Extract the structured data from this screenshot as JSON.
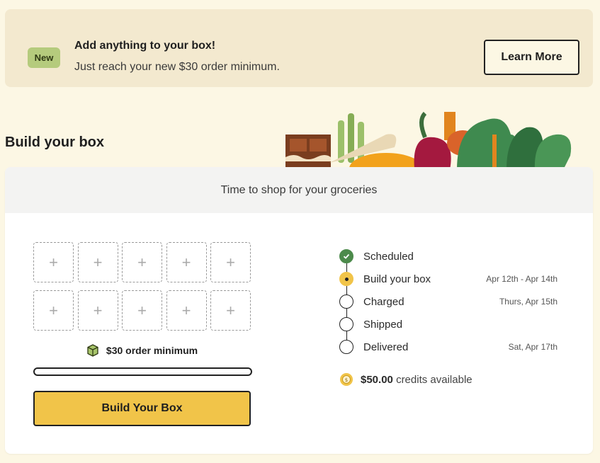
{
  "banner": {
    "badge": "New",
    "title": "Add anything to your box!",
    "subtitle": "Just reach your new $30 order minimum.",
    "cta": "Learn More"
  },
  "page": {
    "title": "Build your box"
  },
  "card": {
    "header": "Time to shop for your groceries",
    "slot_icon": "+",
    "minimum_label": "$30 order minimum",
    "progress": 0,
    "build_button": "Build Your Box",
    "timeline": [
      {
        "label": "Scheduled",
        "date": "",
        "state": "done"
      },
      {
        "label": "Build your box",
        "date": "Apr 12th - Apr 14th",
        "state": "current"
      },
      {
        "label": "Charged",
        "date": "Thurs, Apr 15th",
        "state": "upcoming"
      },
      {
        "label": "Shipped",
        "date": "",
        "state": "upcoming"
      },
      {
        "label": "Delivered",
        "date": "Sat, Apr 17th",
        "state": "upcoming"
      }
    ],
    "credits_amount": "$50.00",
    "credits_text": "credits available"
  },
  "colors": {
    "background": "#fcf7e4",
    "banner_bg": "#f3e9cf",
    "badge_bg": "#b5cb7d",
    "accent_yellow": "#f1c449",
    "done_green": "#4c8a4b"
  },
  "icons": {
    "box": "box-icon",
    "check": "check-icon",
    "coin": "coin-icon"
  }
}
